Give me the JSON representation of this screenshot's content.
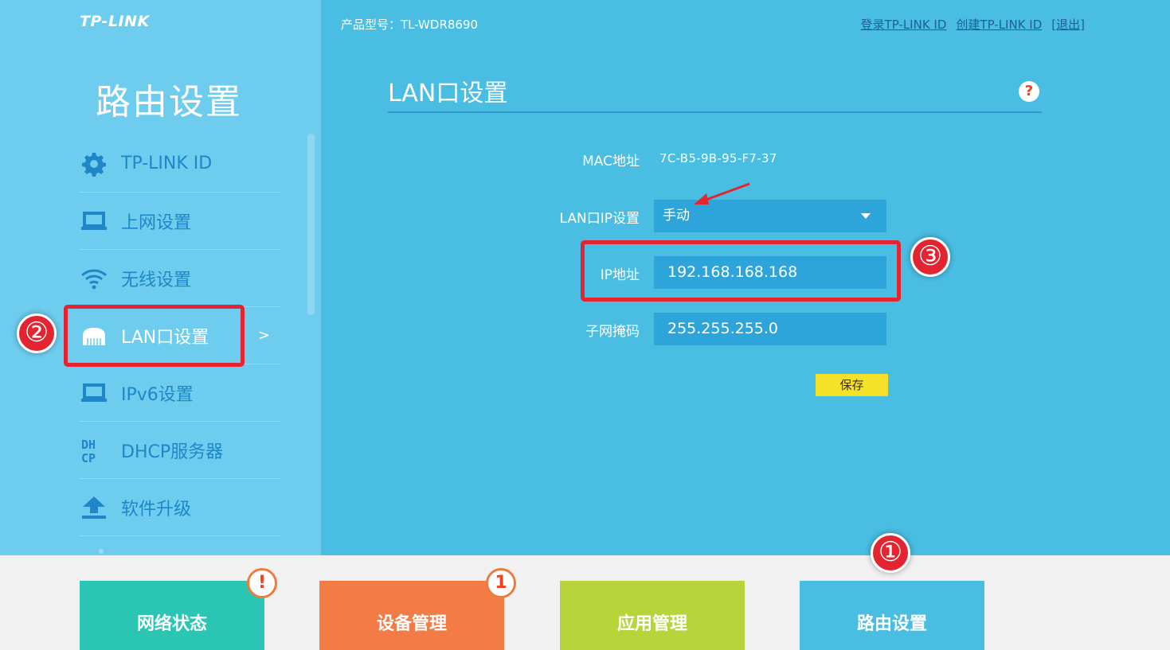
{
  "brand": {
    "logo": "TP-LINK"
  },
  "sidebar": {
    "title": "路由设置",
    "items": [
      {
        "label": "TP-LINK ID",
        "icon": "gear-icon"
      },
      {
        "label": "上网设置",
        "icon": "laptop-icon"
      },
      {
        "label": "无线设置",
        "icon": "wifi-icon"
      },
      {
        "label": "LAN口设置",
        "icon": "router-icon",
        "active": true,
        "arrow": ">"
      },
      {
        "label": "IPv6设置",
        "icon": "laptop-icon"
      },
      {
        "label": "DHCP服务器",
        "icon": "dhcp-icon"
      },
      {
        "label": "软件升级",
        "icon": "upload-icon"
      }
    ]
  },
  "header": {
    "model": "产品型号：TL-WDR8690",
    "links": {
      "login": "登录TP-LINK ID",
      "create": "创建TP-LINK ID",
      "logout": "[退出]"
    }
  },
  "main": {
    "title": "LAN口设置",
    "help": "?",
    "mac_label": "MAC地址",
    "mac_value": "7C-B5-9B-95-F7-37",
    "lan_ip_label": "LAN口IP设置",
    "lan_ip_mode": "手动",
    "ip_label": "IP地址",
    "ip_value": "192.168.168.168",
    "mask_label": "子网掩码",
    "mask_value": "255.255.255.0",
    "save_label": "保存"
  },
  "annotations": {
    "step1": "①",
    "step2": "②",
    "step3": "③"
  },
  "tiles": [
    {
      "label": "网络状态",
      "color": "#2ac6b3",
      "badge": "!"
    },
    {
      "label": "设备管理",
      "color": "#f37b46",
      "badge": "1"
    },
    {
      "label": "应用管理",
      "color": "#b7d43a"
    },
    {
      "label": "路由设置",
      "color": "#4abde3"
    }
  ],
  "colors": {
    "sidebar_bg": "#6ecdee",
    "main_bg": "#4abde3",
    "annotation_red": "#e42531",
    "save_yellow": "#f5e12a"
  }
}
